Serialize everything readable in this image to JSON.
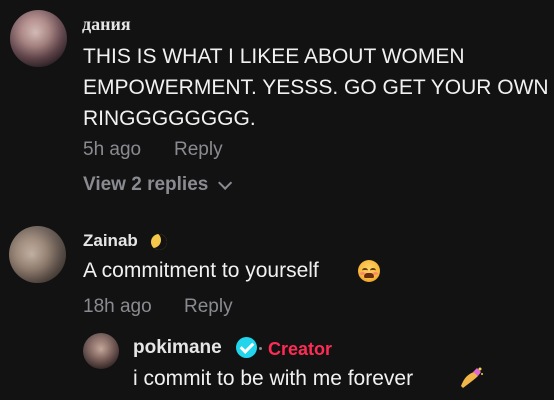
{
  "comments": [
    {
      "username": "дания",
      "text": "THIS IS WHAT I LIKEE ABOUT WOMEN\nEMPOWERMENT. YESSS. GO GET YOUR OWN\nRINGGGGGGGG.",
      "time": "5h ago",
      "reply_label": "Reply",
      "view_replies": "View 2 replies"
    },
    {
      "username": "Zainab",
      "username_emoji": "crescent-moon-icon",
      "text": "A commitment to yourself",
      "text_emoji": "weary-face-icon",
      "time": "18h ago",
      "reply_label": "Reply"
    },
    {
      "username": "pokimane",
      "verified_icon": "verified-check-icon",
      "badge": "Creator",
      "text": "i commit to be with me forever",
      "text_emoji": "nail-polish-icon"
    }
  ],
  "colors": {
    "background": "#121212",
    "text": "#f1f1f2",
    "muted": "#8a8b91",
    "creator": "#fe2c55",
    "verified": "#20d5ec"
  }
}
